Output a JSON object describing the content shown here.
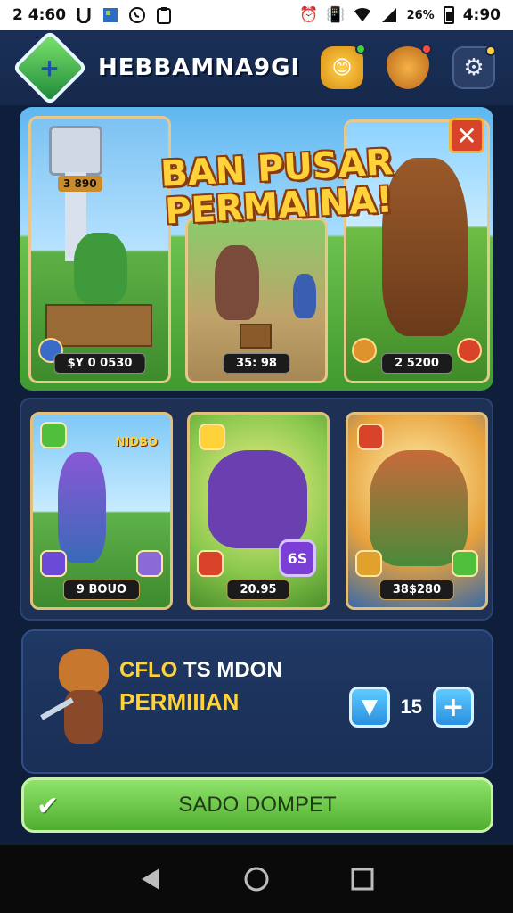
{
  "status_bar": {
    "left_text": "2 4:60",
    "battery": "26%",
    "time_right": "4:90"
  },
  "header": {
    "title": "HEBBAMNA9GI",
    "icons": [
      "logo-diamond-icon",
      "gold-badge-icon",
      "shield-icon",
      "gear-icon"
    ],
    "accent": "#1a2f57"
  },
  "banner": {
    "title": "BAN PUSAR PERMAINA!",
    "close_label": "✕",
    "cards": [
      {
        "name": "card-tower",
        "badge": "3 890",
        "value": "$Y 0 0530"
      },
      {
        "name": "card-goblin",
        "value": "35: 98"
      },
      {
        "name": "card-warrior",
        "value": "2 5200"
      }
    ]
  },
  "grid": {
    "cards": [
      {
        "tag": "NIDBO",
        "value": "9 BOUO"
      },
      {
        "value": "20.95",
        "badge": "6S"
      },
      {
        "value": "38$280"
      }
    ]
  },
  "bonus": {
    "line1_a": "CFLO",
    "line1_b": " TS MDON",
    "line2": "PERMIIIAN",
    "count": "15",
    "plus_label": "+"
  },
  "main_button": {
    "label": "SADO DOMPET"
  }
}
